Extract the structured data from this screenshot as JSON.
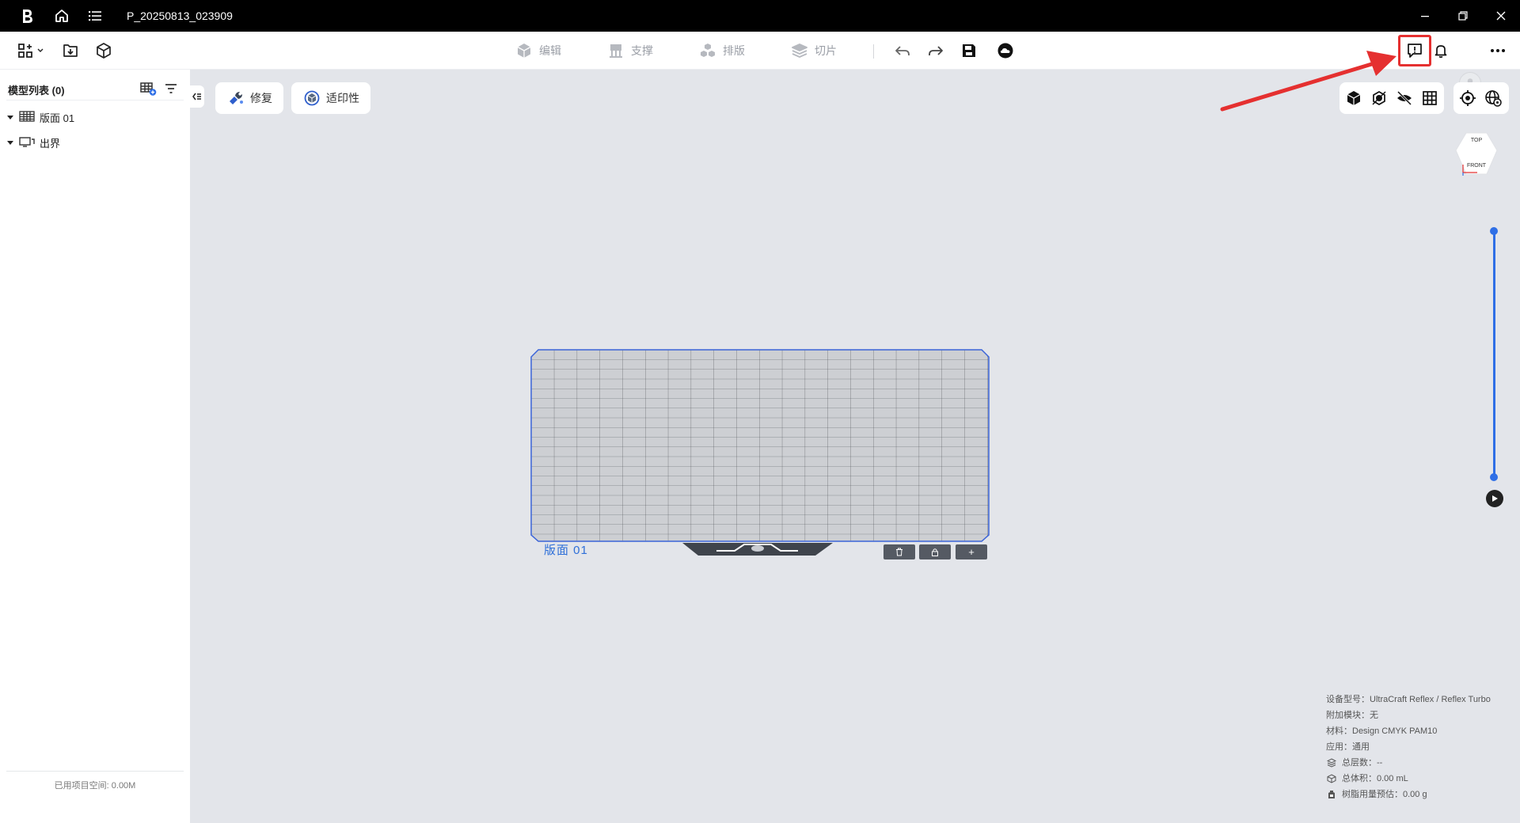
{
  "window": {
    "title": "P_20250813_023909",
    "icons": [
      "app-logo-icon",
      "home-icon",
      "menu-list-icon"
    ],
    "controls": [
      "minimize-icon",
      "restore-icon",
      "close-icon"
    ]
  },
  "toolbar": {
    "left_icons": [
      "grid-apps-icon",
      "import-icon",
      "box-model-icon"
    ],
    "modes": [
      {
        "label": "编辑",
        "icon": "edit-cube-icon"
      },
      {
        "label": "支撑",
        "icon": "support-icon"
      },
      {
        "label": "排版",
        "icon": "layout-icon"
      },
      {
        "label": "切片",
        "icon": "slice-icon"
      }
    ],
    "actions": [
      "undo-icon",
      "redo-icon",
      "save-icon",
      "cloud-icon"
    ],
    "right_icons": [
      "feedback-icon",
      "bell-icon",
      "avatar",
      "more-icon"
    ]
  },
  "sidebar": {
    "title": "模型列表",
    "count": "(0)",
    "tree": [
      {
        "label": "版面 01",
        "icon": "plate-grid-icon"
      },
      {
        "label": "出界",
        "icon": "out-of-bounds-icon"
      }
    ],
    "footer": "已用项目空间: 0.00M"
  },
  "viewport": {
    "buttons": [
      {
        "label": "修复",
        "icon": "repair-icon"
      },
      {
        "label": "适印性",
        "icon": "printability-icon"
      }
    ],
    "view_icons": [
      "solid-view-icon",
      "xray-view-icon",
      "hide-view-icon",
      "grid-view-icon"
    ],
    "camera_icons": [
      "target-icon",
      "globe-settings-icon"
    ],
    "viewcube": {
      "top": "TOP",
      "front": "FRONT"
    },
    "plate_label": "版面 01",
    "plate_buttons": [
      "trash-icon",
      "lock-icon",
      "+"
    ],
    "slider_level": 1.0
  },
  "info": {
    "device": "设备型号：UltraCraft Reflex / Reflex Turbo",
    "module": "附加模块：无",
    "material": "材料：Design CMYK PAM10",
    "application": "应用：通用",
    "layers": "总层数：--",
    "volume": "总体积：0.00 mL",
    "resin": "树脂用量预估：0.00 g"
  },
  "colors": {
    "accent": "#2f6fe6",
    "annotation": "#e53030",
    "viewport_bg": "#e3e5ea",
    "titlebar": "#000000"
  }
}
